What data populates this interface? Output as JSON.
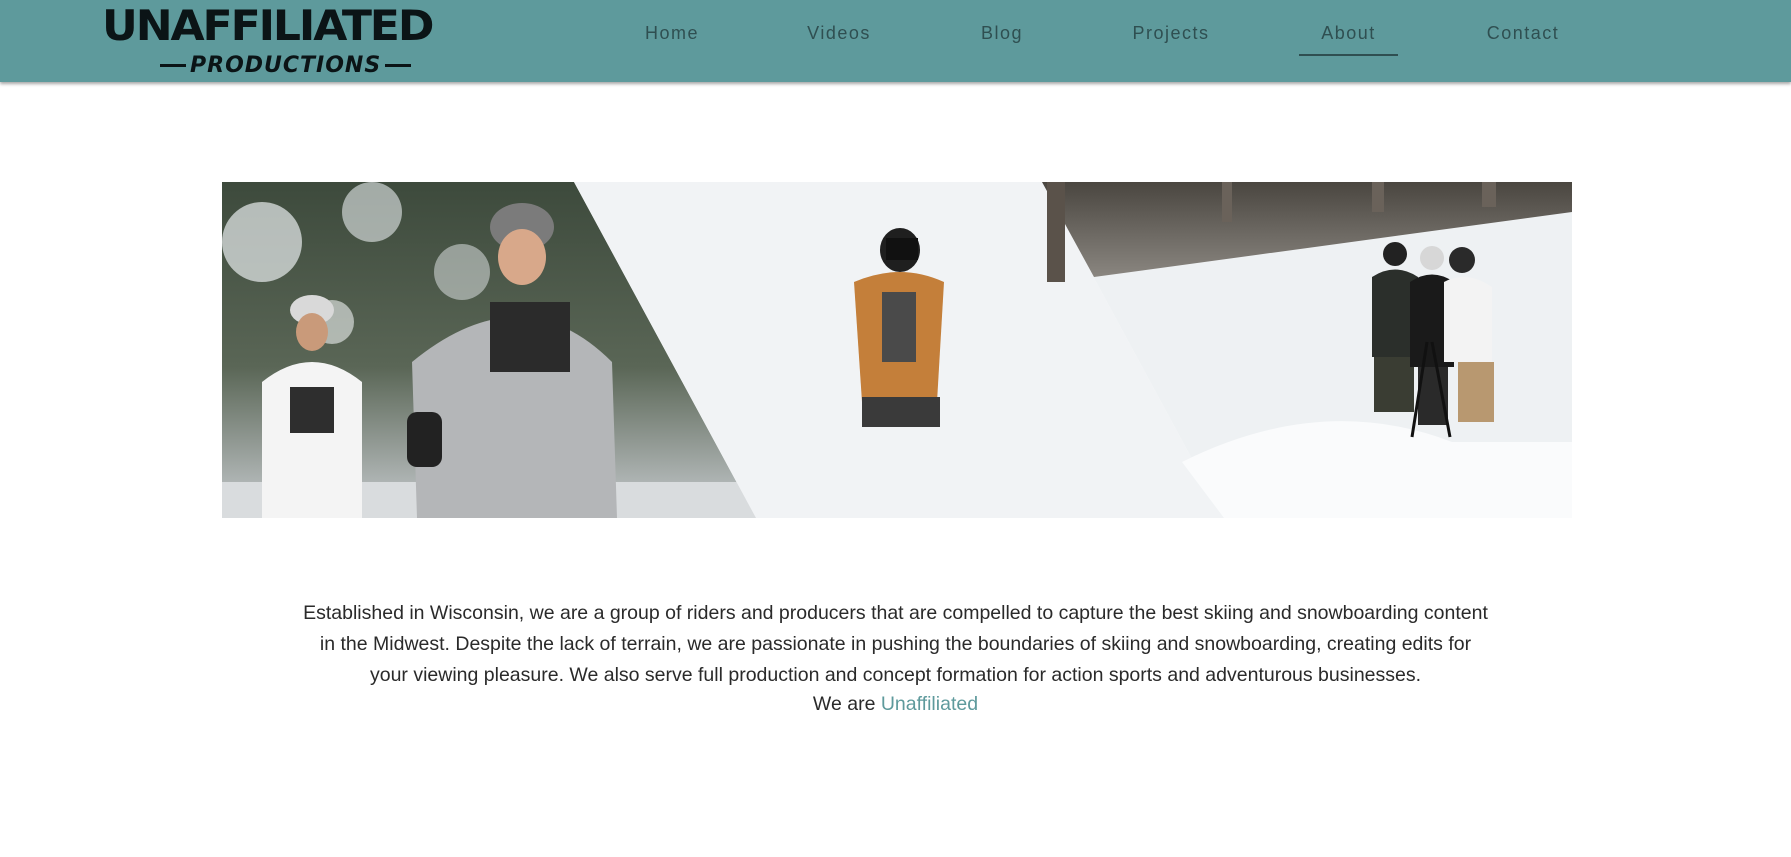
{
  "logo": {
    "main_text": "UNAFFILIATED",
    "sub_text": "PRODUCTIONS"
  },
  "nav": {
    "items": [
      {
        "label": "Home"
      },
      {
        "label": "Videos"
      },
      {
        "label": "Blog"
      },
      {
        "label": "Projects"
      },
      {
        "label": "About",
        "active": true
      },
      {
        "label": "Contact"
      }
    ]
  },
  "about": {
    "paragraph": "Established in Wisconsin, we are a group of riders and producers that are compelled to capture the best skiing and snowboarding content in the Midwest. Despite the lack of terrain, we are passionate in pushing the boundaries of skiing and snowboarding, creating edits for your viewing pleasure. We also serve full production and concept formation for action sports and adventurous businesses.",
    "tagline_prefix": "We are ",
    "tagline_accent": "Unaffiliated"
  },
  "colors": {
    "header_bg": "#5e9a9c",
    "nav_text": "#2f4f51",
    "accent": "#5e9a9c",
    "body_text": "#2a2a2a"
  }
}
